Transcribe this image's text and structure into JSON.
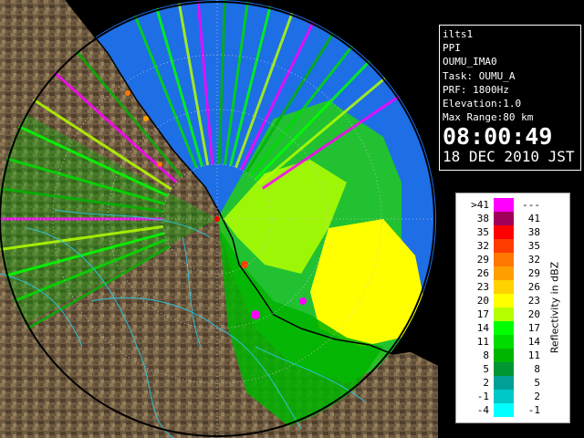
{
  "info": {
    "lines": [
      "ilts1",
      "PPI",
      "OUMU_IMA0",
      "Task: OUMU_A",
      "PRF: 1800Hz",
      "Elevation:1.0",
      "Max Range:80 km"
    ],
    "time": "08:00:49",
    "date": "18 DEC 2010 JST"
  },
  "legend": {
    "title": "Reflectivity in dBZ",
    "rows": [
      {
        "lo": ">41",
        "hi": "---",
        "color": "#ff00ff"
      },
      {
        "lo": "38",
        "hi": "41",
        "color": "#a0005a"
      },
      {
        "lo": "35",
        "hi": "38",
        "color": "#ff0000"
      },
      {
        "lo": "32",
        "hi": "35",
        "color": "#ff3c00"
      },
      {
        "lo": "29",
        "hi": "32",
        "color": "#ff7800"
      },
      {
        "lo": "26",
        "hi": "29",
        "color": "#ffa000"
      },
      {
        "lo": "23",
        "hi": "26",
        "color": "#ffd200"
      },
      {
        "lo": "20",
        "hi": "23",
        "color": "#ffff00"
      },
      {
        "lo": "17",
        "hi": "20",
        "color": "#b4ff00"
      },
      {
        "lo": "14",
        "hi": "17",
        "color": "#00ff00"
      },
      {
        "lo": "11",
        "hi": "14",
        "color": "#00dc00"
      },
      {
        "lo": "8",
        "hi": "11",
        "color": "#00b400"
      },
      {
        "lo": "5",
        "hi": "8",
        "color": "#009632"
      },
      {
        "lo": "2",
        "hi": "5",
        "color": "#00a096"
      },
      {
        "lo": "-1",
        "hi": "2",
        "color": "#00c8c8"
      },
      {
        "lo": "-4",
        "hi": "-1",
        "color": "#00ffff"
      }
    ]
  },
  "colors": {
    "background": "#000000",
    "far_echo": "#1e6ee6",
    "land": "#6e5a41",
    "boundaries": "#28c8e6",
    "coastline": "#000000"
  },
  "icons": {
    "radar_site": "radar-site-icon"
  }
}
